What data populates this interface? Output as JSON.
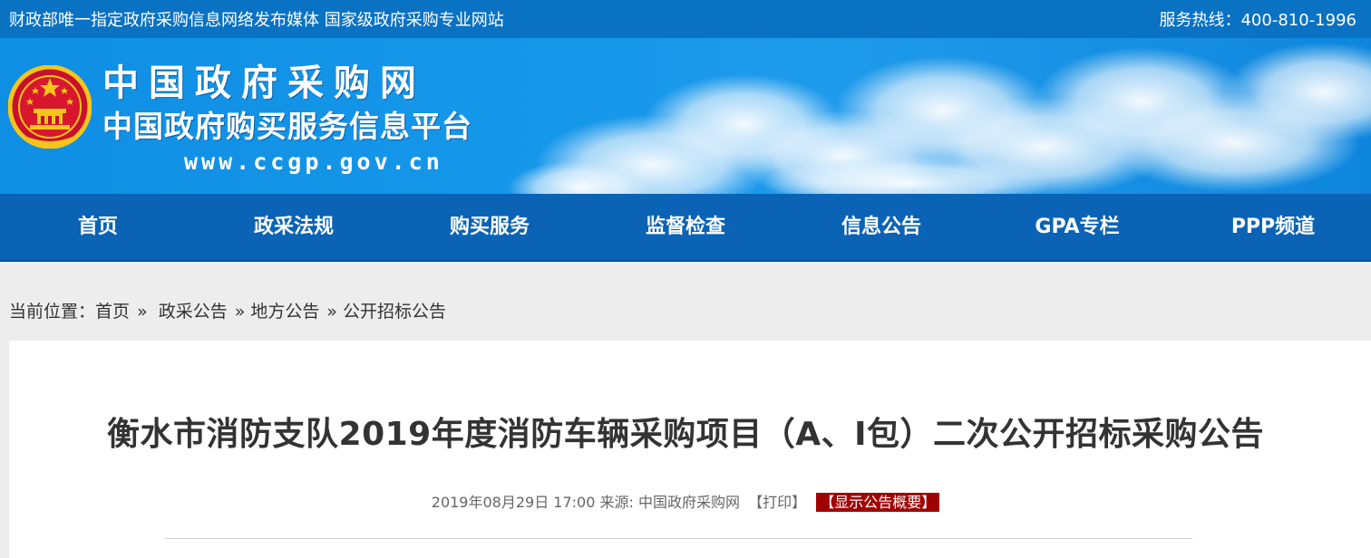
{
  "topbar": {
    "slogan": "财政部唯一指定政府采购信息网络发布媒体 国家级政府采购专业网站",
    "hotline": "服务热线：400-810-1996"
  },
  "banner": {
    "title": "中国政府采购网",
    "subtitle": "中国政府购买服务信息平台",
    "url": "www.ccgp.gov.cn"
  },
  "nav": {
    "items": [
      "首页",
      "政采法规",
      "购买服务",
      "监督检查",
      "信息公告",
      "GPA专栏",
      "PPP频道"
    ]
  },
  "breadcrumb": {
    "prefix": "当前位置：",
    "items": [
      "首页",
      "政采公告",
      "地方公告",
      "公开招标公告"
    ],
    "separator": "»"
  },
  "article": {
    "title": "衡水市消防支队2019年度消防车辆采购项目（A、I包）二次公开招标采购公告",
    "date": "2019年08月29日 17:00",
    "source_label": "来源:",
    "source": "中国政府采购网",
    "print_label": "【打印】",
    "summary_label": "【显示公告概要】"
  },
  "colors": {
    "topbar": "#0a72c3",
    "nav": "#0a63b5",
    "summary_badge": "#a00000"
  }
}
